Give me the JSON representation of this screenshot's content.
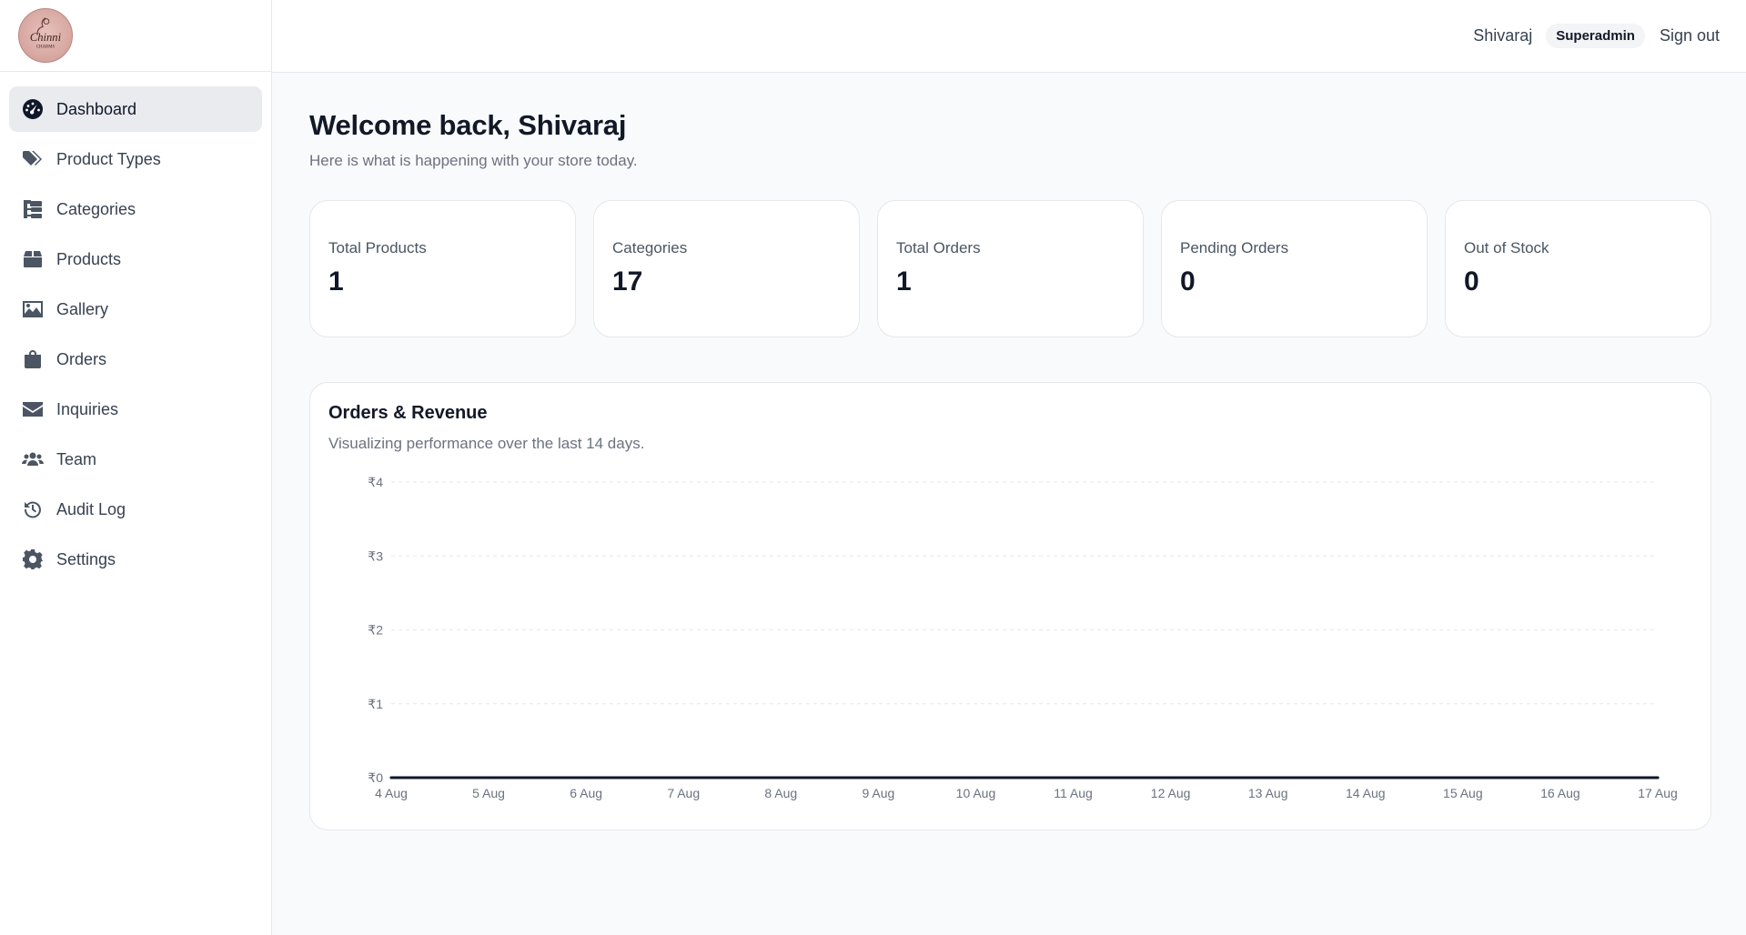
{
  "brand": {
    "logo_text": "Chinni",
    "logo_subtext": "CHARMS"
  },
  "sidebar": {
    "items": [
      {
        "label": "Dashboard",
        "icon": "dashboard-icon",
        "active": true
      },
      {
        "label": "Product Types",
        "icon": "tags-icon"
      },
      {
        "label": "Categories",
        "icon": "categories-icon"
      },
      {
        "label": "Products",
        "icon": "box-icon"
      },
      {
        "label": "Gallery",
        "icon": "image-icon"
      },
      {
        "label": "Orders",
        "icon": "shopping-bag-icon"
      },
      {
        "label": "Inquiries",
        "icon": "envelope-icon"
      },
      {
        "label": "Team",
        "icon": "users-icon"
      },
      {
        "label": "Audit Log",
        "icon": "history-icon"
      },
      {
        "label": "Settings",
        "icon": "gear-icon"
      }
    ]
  },
  "header": {
    "user_name": "Shivaraj",
    "role": "Superadmin",
    "signout_label": "Sign out"
  },
  "main": {
    "welcome": "Welcome back, Shivaraj",
    "subtitle": "Here is what is happening with your store today.",
    "stats": [
      {
        "label": "Total Products",
        "value": "1"
      },
      {
        "label": "Categories",
        "value": "17"
      },
      {
        "label": "Total Orders",
        "value": "1"
      },
      {
        "label": "Pending Orders",
        "value": "0"
      },
      {
        "label": "Out of Stock",
        "value": "0"
      }
    ],
    "chart_panel": {
      "title": "Orders & Revenue",
      "subtitle": "Visualizing performance over the last 14 days."
    }
  },
  "colors": {
    "accent": "#0f172a",
    "line": "#0f172a",
    "grid": "#e5e7eb",
    "active_bg": "#e9ebee"
  },
  "chart_data": {
    "type": "line",
    "categories": [
      "4 Aug",
      "5 Aug",
      "6 Aug",
      "7 Aug",
      "8 Aug",
      "9 Aug",
      "10 Aug",
      "11 Aug",
      "12 Aug",
      "13 Aug",
      "14 Aug",
      "15 Aug",
      "16 Aug",
      "17 Aug"
    ],
    "y_ticks": [
      "₹0",
      "₹1",
      "₹2",
      "₹3",
      "₹4"
    ],
    "series": [
      {
        "values": [
          0,
          0,
          0,
          0,
          0,
          0,
          0,
          0,
          0,
          0,
          0,
          0,
          0,
          0
        ]
      }
    ],
    "ylim": [
      0,
      4
    ],
    "grid": true,
    "grid_style": "dashed-horizontal"
  }
}
